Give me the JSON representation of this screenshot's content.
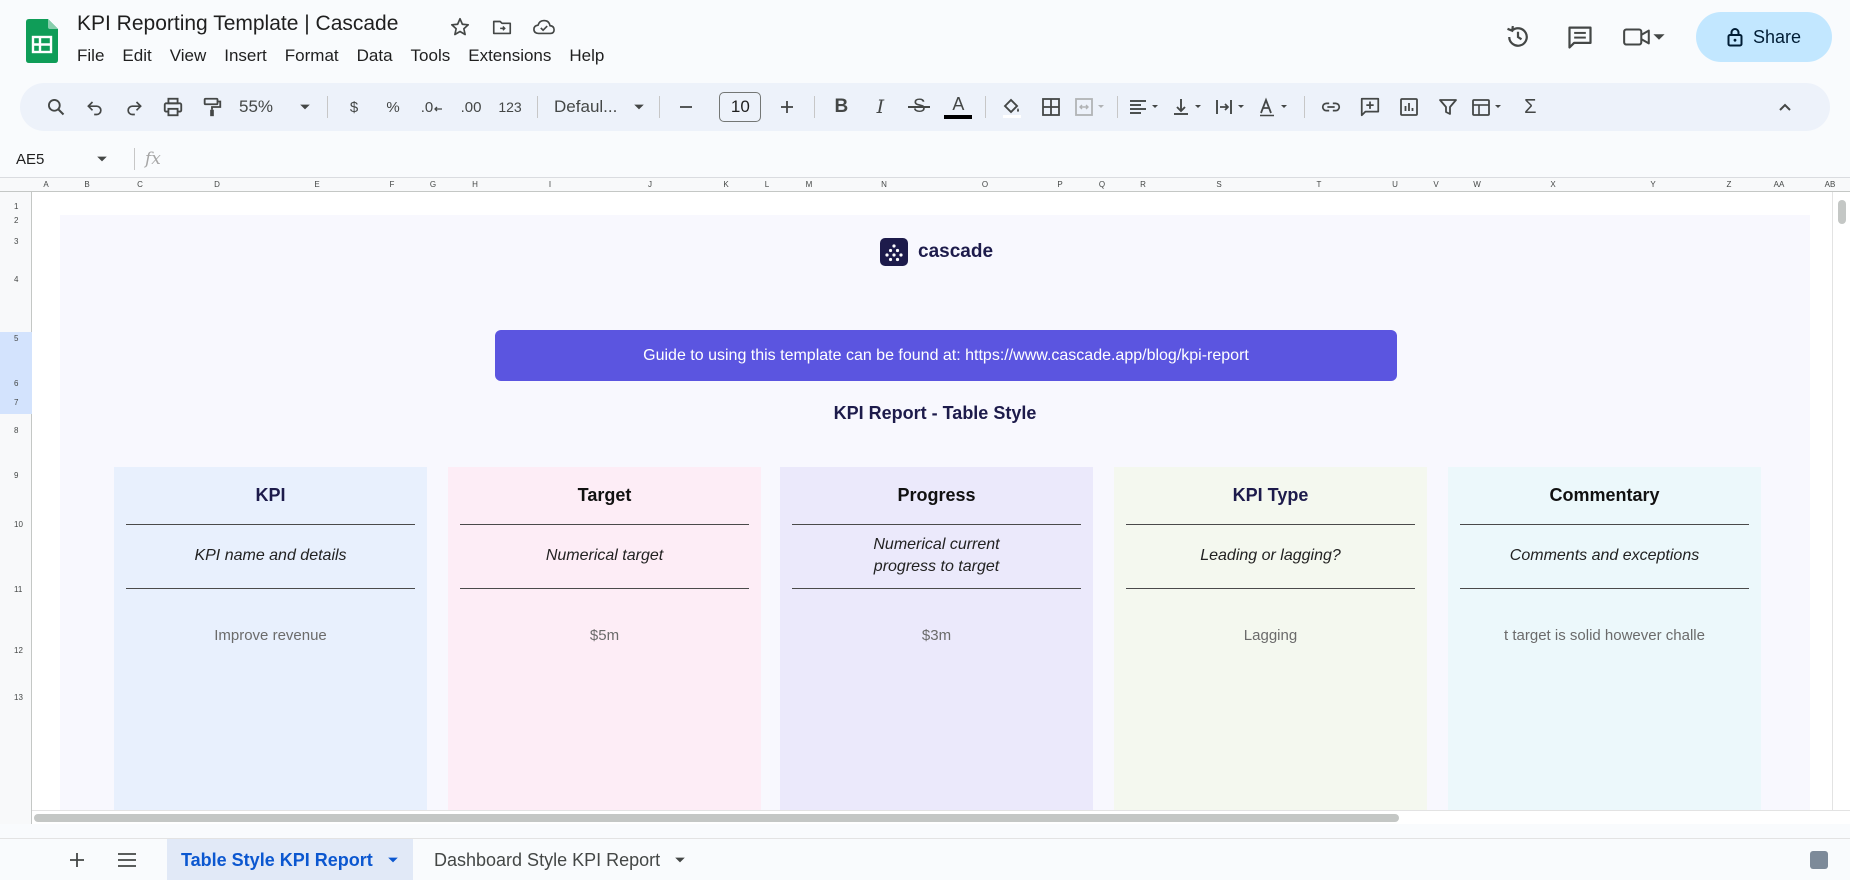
{
  "document": {
    "title": "KPI Reporting Template | Cascade"
  },
  "menu": [
    "File",
    "Edit",
    "View",
    "Insert",
    "Format",
    "Data",
    "Tools",
    "Extensions",
    "Help"
  ],
  "header_actions": {
    "share_label": "Share"
  },
  "toolbar": {
    "zoom": "55%",
    "currency": "$",
    "percent": "%",
    "decimal_decrease": ".0",
    "decimal_increase": ".00",
    "number_format": "123",
    "font_family": "Defaul...",
    "font_size": "10",
    "bold": "B",
    "italic": "I",
    "strikethrough": "S",
    "text_color_glyph": "A",
    "function_glyph": "Σ"
  },
  "formula_bar": {
    "cell_ref": "AE5",
    "fx_label": "fx",
    "value": ""
  },
  "grid": {
    "columns": [
      "A",
      "B",
      "C",
      "D",
      "E",
      "F",
      "G",
      "H",
      "I",
      "J",
      "K",
      "L",
      "M",
      "N",
      "O",
      "P",
      "Q",
      "R",
      "S",
      "T",
      "U",
      "V",
      "W",
      "X",
      "Y",
      "Z",
      "AA",
      "AB"
    ],
    "rows": [
      "1",
      "2",
      "3",
      "4",
      "5",
      "6",
      "7",
      "8",
      "9",
      "10",
      "11",
      "12",
      "13"
    ],
    "selected_row": "5"
  },
  "sheet": {
    "brand_name": "cascade",
    "guide_text": "Guide to using this template can be found at: https://www.cascade.app/blog/kpi-report",
    "report_title": "KPI Report - Table Style",
    "columns": [
      {
        "header": "KPI",
        "description": "KPI name and details",
        "value": "Improve revenue",
        "color": "#e8f0fd"
      },
      {
        "header": "Target",
        "description": "Numerical target",
        "value": "$5m",
        "color": "#fdedf6"
      },
      {
        "header": "Progress",
        "description": "Numerical current progress to target",
        "value": "$3m",
        "color": "#ebe9fb"
      },
      {
        "header": "KPI Type",
        "description": "Leading or lagging?",
        "value": "Lagging",
        "color": "#f4f8ef"
      },
      {
        "header": "Commentary",
        "description": "Comments and exceptions",
        "value": "t target is solid however challe",
        "color": "#ecf8fb"
      }
    ]
  },
  "sheet_tabs": [
    {
      "label": "Table Style KPI Report",
      "active": true
    },
    {
      "label": "Dashboard Style KPI Report",
      "active": false
    }
  ],
  "colors": {
    "accent": "#0b57d0",
    "banner": "#5b55e0",
    "share_bg": "#c2e7ff",
    "sheets_green": "#0f9d58"
  }
}
